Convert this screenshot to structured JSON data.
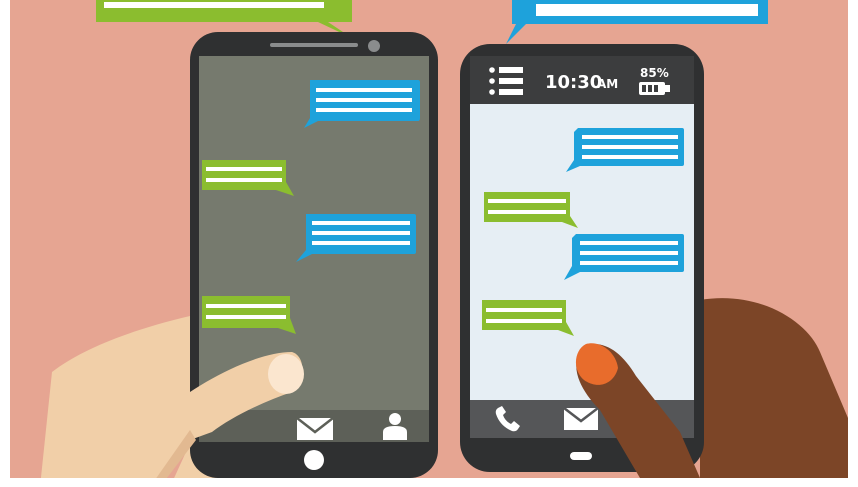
{
  "status_bar": {
    "time": "10:30",
    "ampm": "AM",
    "battery_percent": "85%",
    "menu_icon": "list-menu-icon",
    "battery_icon": "battery-icon"
  },
  "left_phone": {
    "nav_icons": [
      "envelope-icon",
      "person-icon"
    ],
    "messages": [
      {
        "side": "sent",
        "color": "#1ea2db"
      },
      {
        "side": "received",
        "color": "#8bbd2f"
      },
      {
        "side": "sent",
        "color": "#1ea2db"
      },
      {
        "side": "received",
        "color": "#8bbd2f"
      }
    ]
  },
  "right_phone": {
    "nav_icons": [
      "phone-icon",
      "envelope-icon"
    ],
    "messages": [
      {
        "side": "sent",
        "color": "#1ea2db"
      },
      {
        "side": "received",
        "color": "#8bbd2f"
      },
      {
        "side": "sent",
        "color": "#1ea2db"
      },
      {
        "side": "received",
        "color": "#8bbd2f"
      }
    ]
  },
  "colors": {
    "background": "#e6a592",
    "sent_bubble": "#1ea2db",
    "received_bubble": "#8bbd2f",
    "left_screen": "#767a6e",
    "right_screen": "#e6eef4",
    "phone_body": "#2f3031"
  }
}
